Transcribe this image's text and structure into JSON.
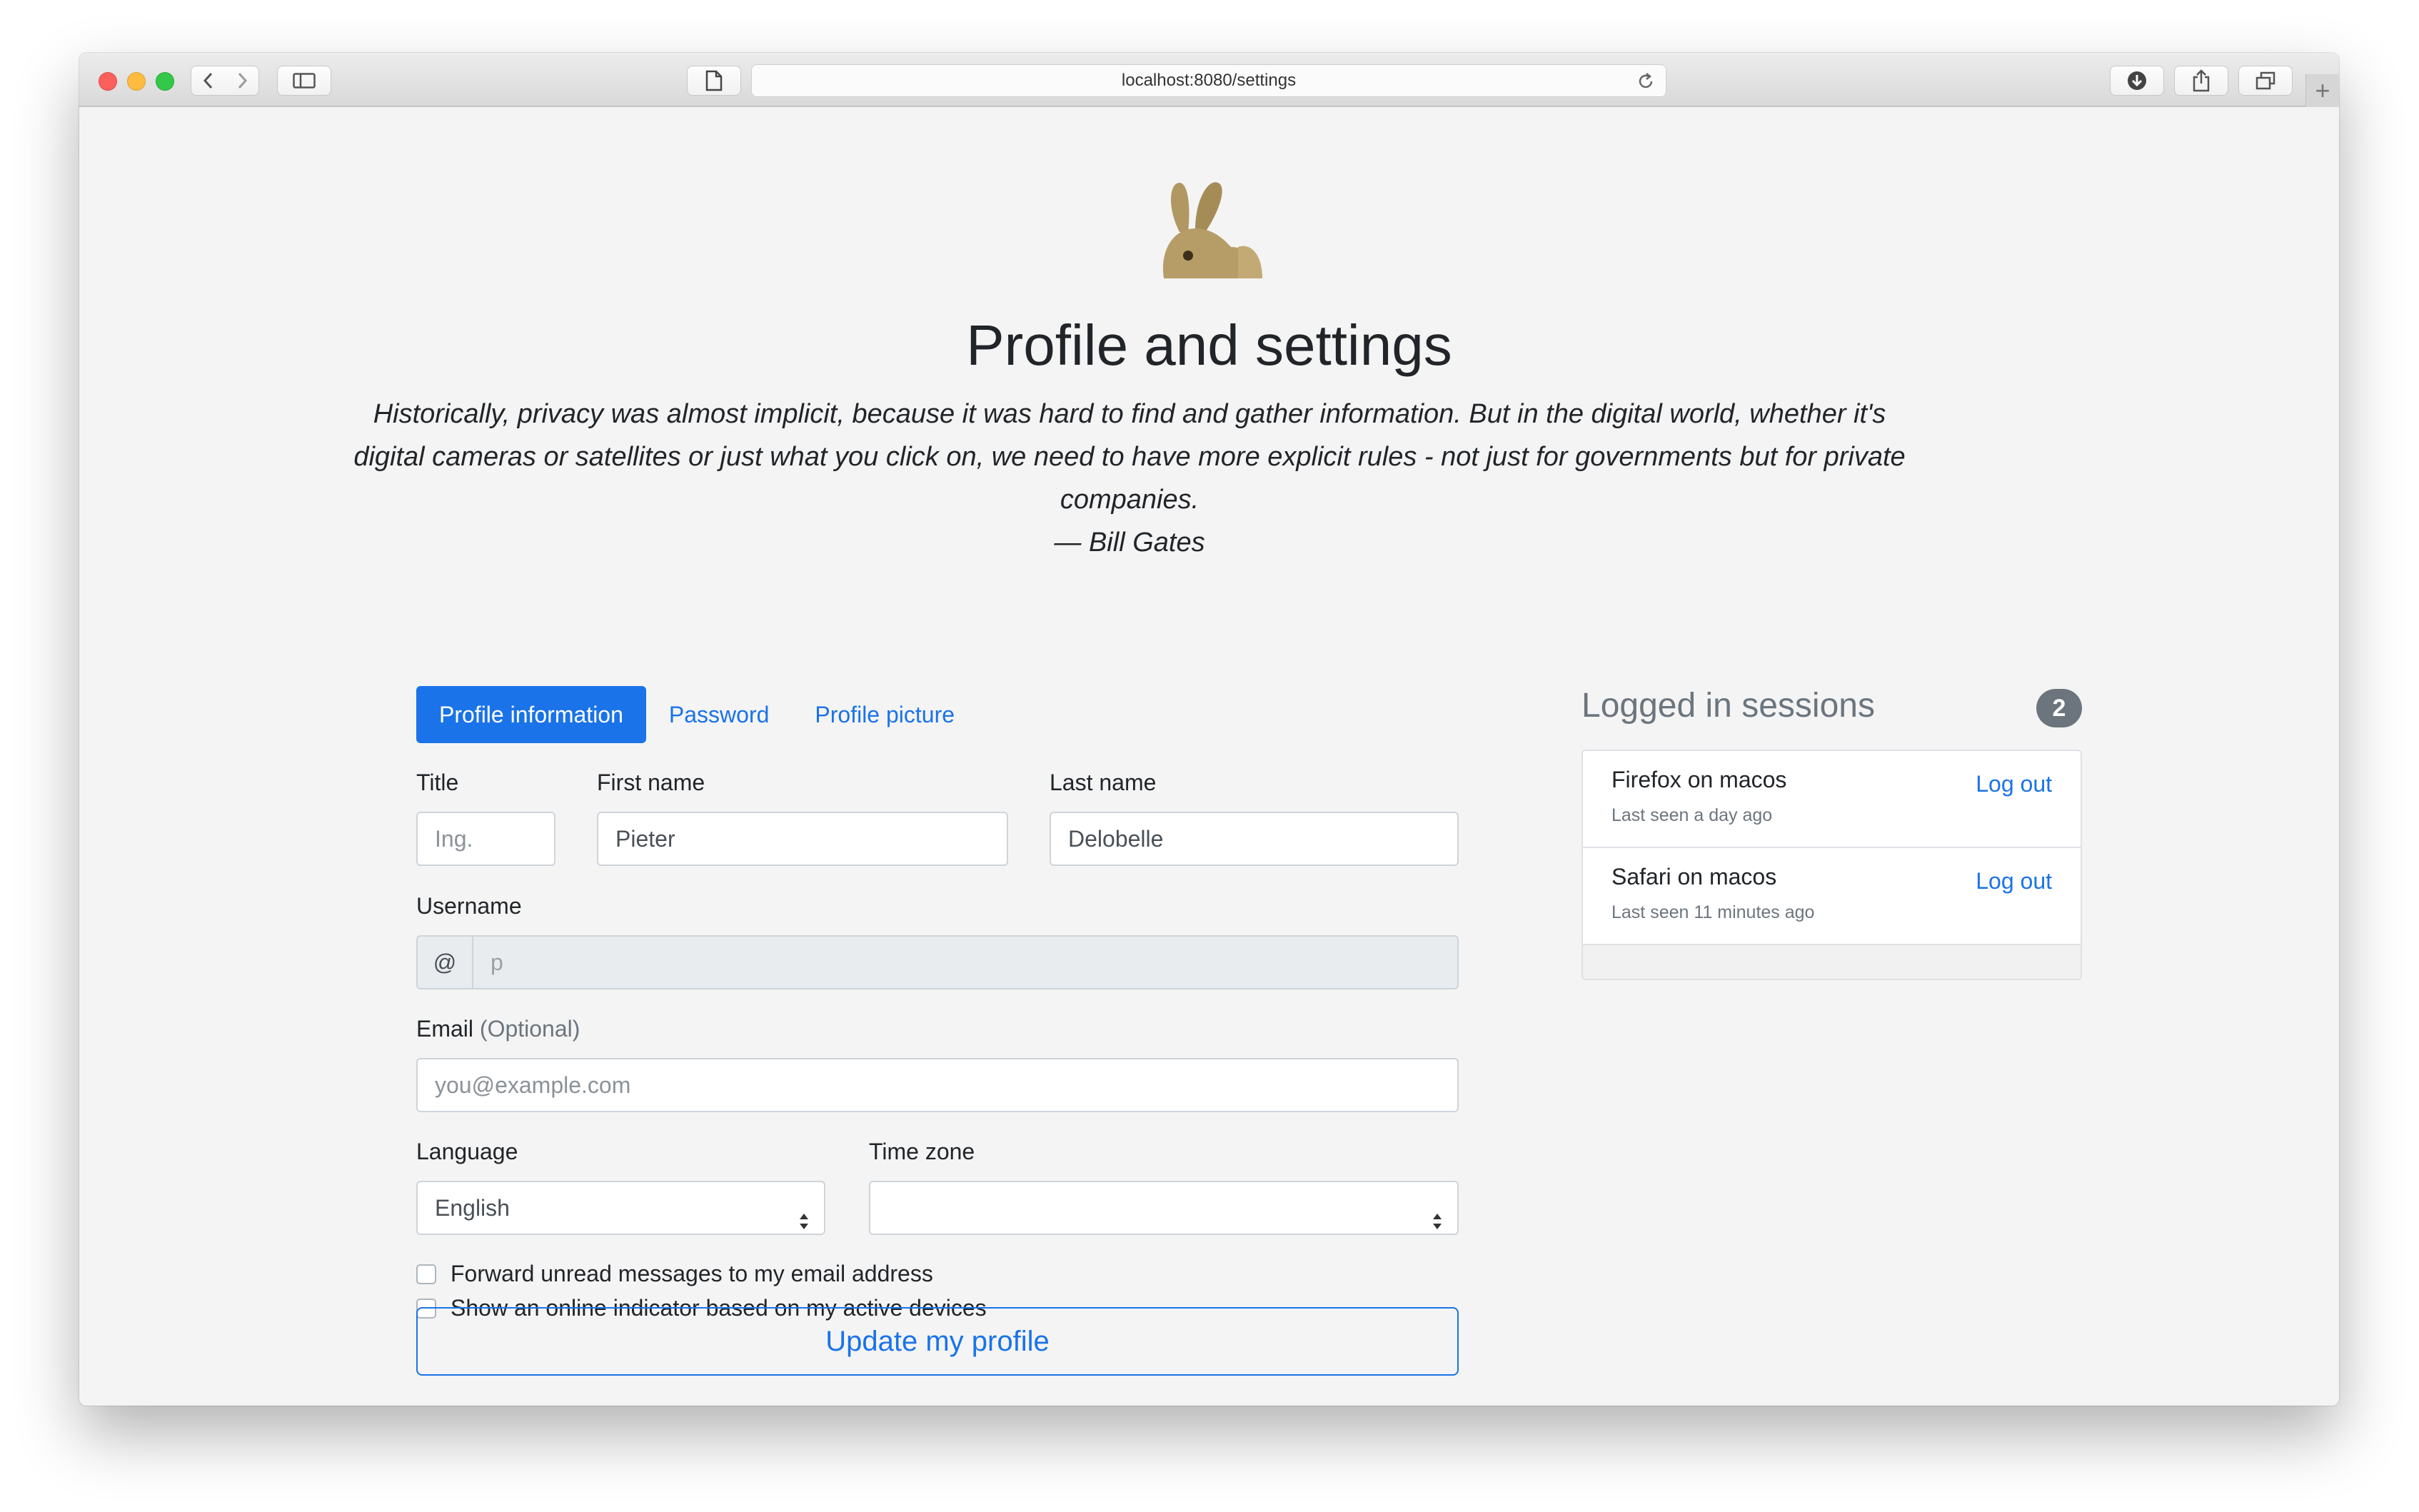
{
  "browser": {
    "url": "localhost:8080/settings"
  },
  "page": {
    "title": "Profile and settings",
    "quote": "Historically, privacy was almost implicit, because it was hard to find and gather information. But in the digital world, whether it's digital cameras or satellites or just what you click on, we need to have more explicit rules - not just for governments but for private companies.",
    "quote_author": "— Bill Gates"
  },
  "tabs": [
    {
      "label": "Profile information",
      "active": true
    },
    {
      "label": "Password",
      "active": false
    },
    {
      "label": "Profile picture",
      "active": false
    }
  ],
  "form": {
    "title_label": "Title",
    "title_placeholder": "Ing.",
    "first_name_label": "First name",
    "first_name_value": "Pieter",
    "last_name_label": "Last name",
    "last_name_value": "Delobelle",
    "username_label": "Username",
    "username_prefix": "@",
    "username_value": "p",
    "email_label": "Email",
    "email_optional": "(Optional)",
    "email_placeholder": "you@example.com",
    "language_label": "Language",
    "language_value": "English",
    "timezone_label": "Time zone",
    "timezone_value": "",
    "checkbox_forward": "Forward unread messages to my email address",
    "checkbox_online": "Show an online indicator based on my active devices",
    "submit_label": "Update my profile"
  },
  "sessions": {
    "title": "Logged in sessions",
    "count": "2",
    "items": [
      {
        "name": "Firefox on macos",
        "seen": "Last seen a day ago",
        "action": "Log out"
      },
      {
        "name": "Safari on macos",
        "seen": "Last seen 11 minutes ago",
        "action": "Log out"
      }
    ]
  },
  "colors": {
    "primary": "#1a73e8",
    "muted": "#6c757d",
    "background": "#f4f4f4"
  },
  "icons": [
    "back-icon",
    "forward-icon",
    "sidebar-icon",
    "page-icon",
    "reload-icon",
    "download-icon",
    "share-icon",
    "tabs-icon",
    "plus-icon",
    "rabbit-logo-icon",
    "select-arrows-icon"
  ]
}
